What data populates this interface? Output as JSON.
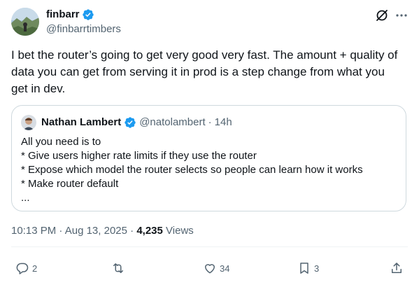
{
  "author": {
    "name": "finbarr",
    "handle": "@finbarrtimbers",
    "verified": true
  },
  "tweet": {
    "text": "I bet the router’s going to get very good very fast. The amount + quality of\ndata you can get from serving it in prod is a step change from what you\nget in dev."
  },
  "quote": {
    "name": "Nathan Lambert",
    "handle": "@natolambert",
    "separator": "·",
    "time": "14h",
    "text": "All you need is to\n* Give users higher rate limits if they use the router\n* Expose which model the router selects so people can learn how it works\n* Make router default\n..."
  },
  "meta": {
    "time": "10:13 PM",
    "sep1": "·",
    "date": "Aug 13, 2025",
    "sep2": "·",
    "views_count": "4,235",
    "views_label": "Views"
  },
  "actions": {
    "replies": "2",
    "reposts": "",
    "likes": "34",
    "bookmarks": "3"
  },
  "colors": {
    "verified": "#1d9bf0",
    "secondary_text": "#536471",
    "border": "#cfd9de"
  },
  "icons": [
    "verified-badge-icon",
    "grok-icon",
    "more-icon",
    "reply-icon",
    "repost-icon",
    "like-icon",
    "bookmark-icon",
    "share-icon"
  ]
}
